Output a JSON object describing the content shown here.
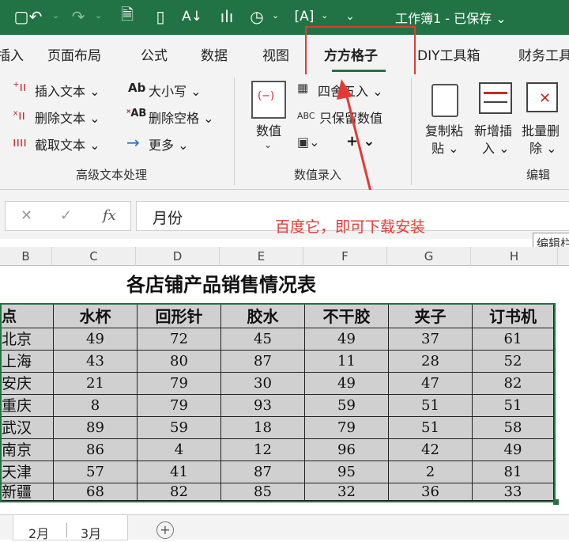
{
  "titlebar": {
    "doc_title": "工作簿1 - 已保存",
    "icons": [
      "undo-icon",
      "redo-icon",
      "save-pdf-icon",
      "new-doc-icon",
      "sort-az-icon",
      "chart-icon",
      "shapes-icon",
      "textbox-icon",
      "more-icon"
    ]
  },
  "tabs": [
    {
      "label": "插入"
    },
    {
      "label": "页面布局"
    },
    {
      "label": "公式"
    },
    {
      "label": "数据"
    },
    {
      "label": "视图"
    },
    {
      "label": "方方格子",
      "active": true
    },
    {
      "label": "DIY工具箱"
    },
    {
      "label": "财务工具"
    }
  ],
  "ribbon": {
    "text_group": {
      "insert_text": "插入文本",
      "delete_text": "删除文本",
      "cut_text": "截取文本",
      "case_label": "大小写",
      "case_icon_text": "Ab",
      "delete_space": "删除空格",
      "delete_space_icon_text": "AB",
      "more": "更多",
      "group_label": "高级文本处理"
    },
    "value_group": {
      "value_btn": "数值",
      "round": "四舍五入",
      "keep_value": "只保留数值",
      "keep_value_icon_text": "ABC",
      "group_label": "数值录入"
    },
    "edit_group": {
      "copy_paste": "复制粘\n贴",
      "copy_paste_l1": "复制粘",
      "copy_paste_l2": "贴",
      "add_insert_l1": "新增插",
      "add_insert_l2": "入",
      "batch_delete_l1": "批量删",
      "batch_delete_l2": "除",
      "group_label": "编辑"
    }
  },
  "formula_bar": {
    "fx": "fx",
    "value": "月份"
  },
  "annotation": "百度它，即可下载安装",
  "tooltip": "编辑栏",
  "columns": [
    "B",
    "C",
    "D",
    "E",
    "F",
    "G",
    "H"
  ],
  "sheet": {
    "title": "各店铺产品销售情况表",
    "headers": [
      "点",
      "水杯",
      "回形针",
      "胶水",
      "不干胶",
      "夹子",
      "订书机"
    ],
    "rows": [
      [
        "北京",
        "49",
        "72",
        "45",
        "49",
        "37",
        "61"
      ],
      [
        "上海",
        "43",
        "80",
        "87",
        "11",
        "28",
        "52"
      ],
      [
        "安庆",
        "21",
        "79",
        "30",
        "49",
        "47",
        "82"
      ],
      [
        "重庆",
        "8",
        "79",
        "93",
        "59",
        "51",
        "51"
      ],
      [
        "武汉",
        "89",
        "59",
        "18",
        "79",
        "51",
        "58"
      ],
      [
        "南京",
        "86",
        "4",
        "12",
        "96",
        "42",
        "49"
      ],
      [
        "天津",
        "57",
        "41",
        "87",
        "95",
        "2",
        "81"
      ],
      [
        "新疆",
        "68",
        "82",
        "85",
        "32",
        "36",
        "33"
      ]
    ]
  },
  "sheet_tabs": [
    "2月",
    "3月"
  ],
  "colors": {
    "accent": "#217346",
    "highlight": "#e53935",
    "table_fill": "#d0d0d0"
  }
}
